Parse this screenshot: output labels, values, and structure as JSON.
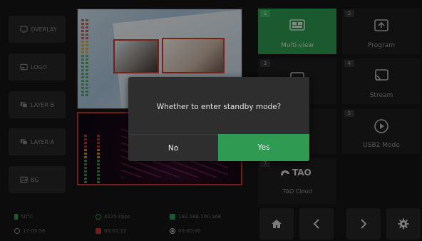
{
  "left_buttons": [
    {
      "label": "OVERLAY",
      "icon": "monitor-icon"
    },
    {
      "label": "LOGO",
      "icon": "logo-icon"
    },
    {
      "label": "LAYER B",
      "icon": "layers-icon"
    },
    {
      "label": "LAYER A",
      "icon": "layers-icon"
    },
    {
      "label": "BG",
      "icon": "image-icon"
    }
  ],
  "tiles": [
    {
      "num": "1",
      "label": "Multi-view",
      "icon": "multiview-icon",
      "active": true
    },
    {
      "num": "2",
      "label": "Program",
      "icon": "upload-screen-icon",
      "active": false
    },
    {
      "num": "3",
      "label": "",
      "icon": "monitor-icon",
      "active": false
    },
    {
      "num": "4",
      "label": "Stream",
      "icon": "cast-icon",
      "active": false
    },
    {
      "num": "5",
      "label": "USB2 Mode",
      "icon": "play-circle-icon",
      "active": false
    },
    {
      "num": "7",
      "label": "TAO Cloud",
      "icon": "tao-cloud-icon",
      "brand": "TAO",
      "active": false
    }
  ],
  "status": {
    "temperature": "50°C",
    "bitrate": "4225 kbps",
    "ip": "192.168.100.168",
    "clock": "17:09:56",
    "live_time": "00:01:22",
    "record_time": "00:00:00"
  },
  "colors": {
    "accent_green": "#2f9b52",
    "program_red": "#c0392b",
    "dialog_bg": "#2e2e2e"
  },
  "dialog": {
    "message": "Whether to enter standby mode?",
    "no_label": "No",
    "yes_label": "Yes"
  }
}
